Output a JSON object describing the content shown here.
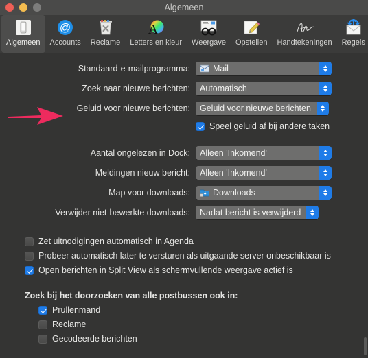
{
  "window": {
    "title": "Algemeen",
    "traffic_lights": [
      "close-button",
      "minimize-button",
      "zoom-button"
    ]
  },
  "toolbar": {
    "items": [
      {
        "label": "Algemeen",
        "icon": "general-device-icon",
        "selected": true
      },
      {
        "label": "Accounts",
        "icon": "at-sign-icon",
        "selected": false
      },
      {
        "label": "Reclame",
        "icon": "junk-trash-icon",
        "selected": false
      },
      {
        "label": "Letters en kleur",
        "icon": "fonts-colors-icon",
        "selected": false
      },
      {
        "label": "Weergave",
        "icon": "viewing-glasses-icon",
        "selected": false
      },
      {
        "label": "Opstellen",
        "icon": "compose-pencil-icon",
        "selected": false
      },
      {
        "label": "Handtekeningen",
        "icon": "signature-icon",
        "selected": false
      },
      {
        "label": "Regels",
        "icon": "rules-envelope-icon",
        "selected": false
      }
    ]
  },
  "form": {
    "rows": [
      {
        "label": "Standaard-e-mailprogramma:",
        "value": "Mail",
        "icon": "mail-app-icon",
        "width": "wide"
      },
      {
        "label": "Zoek naar nieuwe berichten:",
        "value": "Automatisch",
        "icon": null,
        "width": "wide"
      },
      {
        "label": "Geluid voor nieuwe berichten:",
        "value": "Geluid voor nieuwe berichten",
        "icon": null,
        "width": "auto"
      },
      {
        "label": "Aantal ongelezen in Dock:",
        "value": "Alleen 'Inkomend'",
        "icon": null,
        "width": "wide"
      },
      {
        "label": "Meldingen nieuw bericht:",
        "value": "Alleen 'Inkomend'",
        "icon": null,
        "width": "wide"
      },
      {
        "label": "Map voor downloads:",
        "value": "Downloads",
        "icon": "downloads-folder-icon",
        "width": "wide"
      },
      {
        "label": "Verwijder niet-bewerkte downloads:",
        "value": "Nadat bericht is verwijderd",
        "icon": null,
        "width": "auto"
      }
    ],
    "sound_checkbox": {
      "label": "Speel geluid af bij andere taken",
      "checked": true
    }
  },
  "options": [
    {
      "label": "Zet uitnodigingen automatisch in Agenda",
      "checked": false
    },
    {
      "label": "Probeer automatisch later te versturen als uitgaande server onbeschikbaar is",
      "checked": false
    },
    {
      "label": "Open berichten in Split View als schermvullende weergave actief is",
      "checked": true
    }
  ],
  "search_group": {
    "title": "Zoek bij het doorzoeken van alle postbussen ook in:",
    "items": [
      {
        "label": "Prullenmand",
        "checked": true
      },
      {
        "label": "Reclame",
        "checked": false
      },
      {
        "label": "Gecodeerde berichten",
        "checked": false
      }
    ]
  },
  "annotation": {
    "arrow": {
      "name": "pink-pointer-arrow",
      "color": "#ED2B5E",
      "points_to": "Geluid voor nieuwe berichten:"
    }
  },
  "colors": {
    "window_bg": "#343433",
    "titlebar_bg": "#4A4A49",
    "toolbar_bg": "#3B3B3A",
    "accent_blue": "#1F7CE8",
    "popup_bg": "#6E6E6D",
    "text": "#E6E6E4",
    "arrow_pink": "#ED2B5E"
  }
}
